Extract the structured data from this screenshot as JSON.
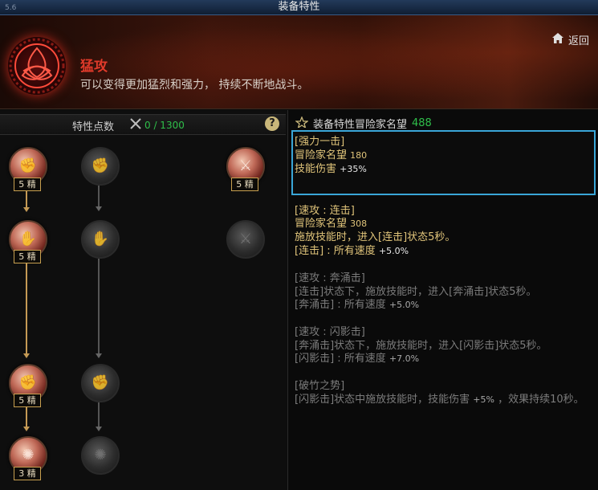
{
  "window": {
    "title": "装备特性",
    "corner_ticks": "5.6"
  },
  "header": {
    "title": "猛攻",
    "description": "可以变得更加猛烈和强力，  持续不断地战斗。",
    "return_label": "返回",
    "home_icon": "home-icon",
    "emblem_icon": "triquetra-emblem-icon"
  },
  "points": {
    "label": "特性点数",
    "value": "0 / 1300",
    "help": "?"
  },
  "tree": {
    "nodes": [
      {
        "level": "5 精",
        "state": "active"
      },
      {
        "level": "",
        "state": "inactive"
      },
      {
        "level": "5 精",
        "state": "active"
      },
      {
        "level": "5 精",
        "state": "active"
      },
      {
        "level": "",
        "state": "inactive"
      },
      {
        "level": "",
        "state": "inactive"
      },
      {
        "level": "5 精",
        "state": "active"
      },
      {
        "level": "",
        "state": "inactive"
      },
      {
        "level": "3 精",
        "state": "active"
      },
      {
        "level": "",
        "state": "inactive"
      }
    ]
  },
  "fame": {
    "label": "装备特性冒险家名望",
    "value": "488"
  },
  "selected": {
    "name": "[强力一击]",
    "fame_label": "冒险家名望",
    "fame_value": "180",
    "effect_label": "技能伤害",
    "effect_value": "+35%"
  },
  "details": {
    "combo": {
      "name": "[速攻 : 连击]",
      "fame_label": "冒险家名望",
      "fame_value": "308",
      "line1": "施放技能时，进入[连击]状态5秒。",
      "line2_label": "[连击] : 所有速度",
      "line2_value": "+5.0%"
    },
    "rush": {
      "name": "[速攻 : 奔涌击]",
      "line1": "[连击]状态下，施放技能时，进入[奔涌击]状态5秒。",
      "line2_label": "[奔涌击] : 所有速度",
      "line2_value": "+5.0%"
    },
    "flash": {
      "name": "[速攻 : 闪影击]",
      "line1": "[奔涌击]状态下，施放技能时，进入[闪影击]状态5秒。",
      "line2_label": "[闪影击] : 所有速度",
      "line2_value": "+7.0%"
    },
    "bamboo": {
      "name": "[破竹之势]",
      "line1_a": "[闪影击]状态中施放技能时，技能伤害",
      "line1_value": "+5%",
      "line1_b": "，效果持续10秒。"
    }
  }
}
